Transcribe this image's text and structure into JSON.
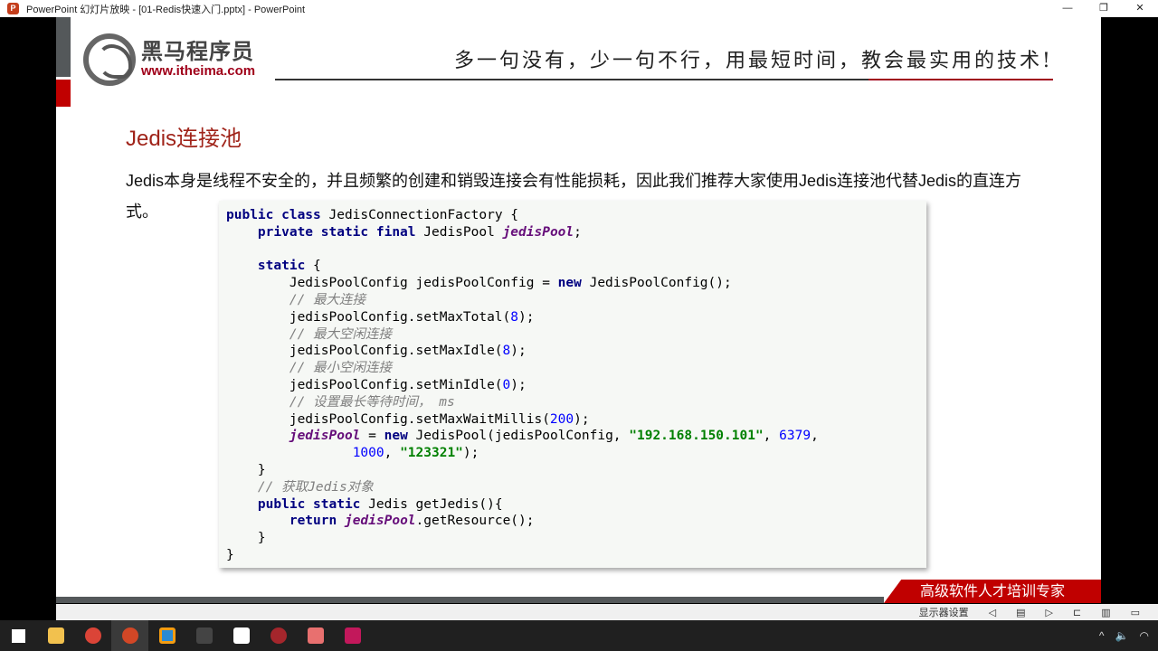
{
  "window": {
    "title": "PowerPoint 幻灯片放映 - [01-Redis快速入门.pptx] - PowerPoint",
    "app_icon": "powerpoint-icon"
  },
  "slide": {
    "logo_cn": "黑马程序员",
    "logo_url": "www.itheima.com",
    "slogan": "多一句没有，少一句不行，用最短时间，教会最实用的技术!",
    "heading": "Jedis连接池",
    "paragraph": "Jedis本身是线程不安全的，并且频繁的创建和销毁连接会有性能损耗，因此我们推荐大家使用Jedis连接池代替Jedis的直连方式。",
    "footer": "高级软件人才培训专家"
  },
  "status": {
    "display_settings": "显示器设置"
  },
  "accent": "#c00000"
}
